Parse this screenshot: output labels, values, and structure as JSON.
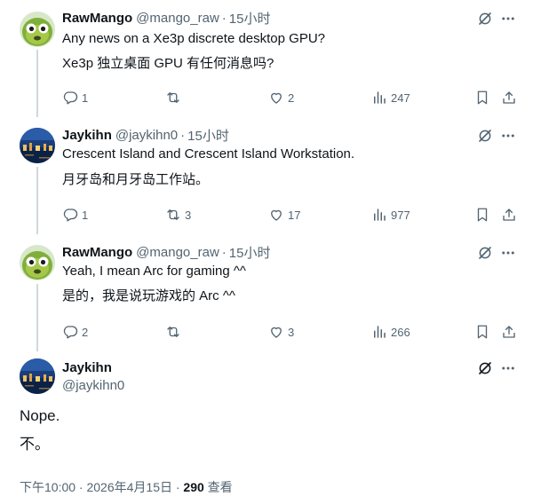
{
  "replies": [
    {
      "name": "RawMango",
      "handle": "@mango_raw",
      "separator": "·",
      "time": "15小时",
      "lines": [
        "Any news on a Xe3p discrete desktop GPU?",
        "Xe3p 独立桌面 GPU 有任何消息吗?"
      ],
      "counts": {
        "reply": "1",
        "repost": "",
        "like": "2",
        "views": "247"
      }
    },
    {
      "name": "Jaykihn",
      "handle": "@jaykihn0",
      "separator": "·",
      "time": "15小时",
      "lines": [
        "Crescent Island and Crescent Island Workstation.",
        "月牙岛和月牙岛工作站。"
      ],
      "counts": {
        "reply": "1",
        "repost": "3",
        "like": "17",
        "views": "977"
      }
    },
    {
      "name": "RawMango",
      "handle": "@mango_raw",
      "separator": "·",
      "time": "15小时",
      "lines": [
        "Yeah, I mean Arc for gaming ^^",
        "是的，我是说玩游戏的 Arc ^^"
      ],
      "counts": {
        "reply": "2",
        "repost": "",
        "like": "3",
        "views": "266"
      }
    }
  ],
  "main_post": {
    "name": "Jaykihn",
    "handle": "@jaykihn0",
    "lines": [
      "Nope.",
      "不。"
    ],
    "timestamp": "下午10:00 · 2026年4月15日 · ",
    "views_count": "290",
    "views_label": " 查看"
  },
  "icons": [
    "grok-icon",
    "more-icon",
    "reply-icon",
    "repost-icon",
    "like-icon",
    "views-icon",
    "bookmark-icon",
    "share-icon"
  ],
  "colors": {
    "text": "#0f1419",
    "muted": "#536471",
    "thread_line": "#cfd9de"
  }
}
